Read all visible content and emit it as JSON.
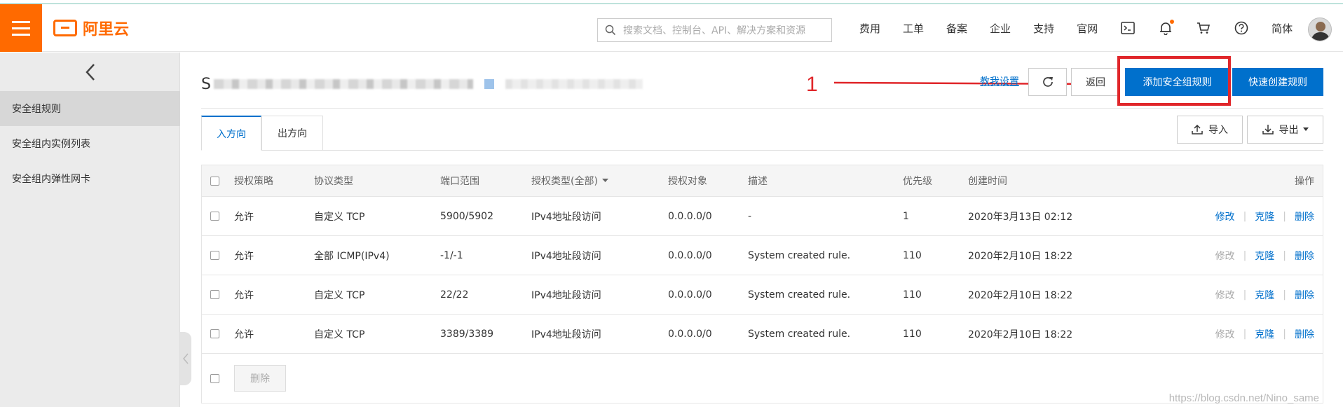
{
  "header": {
    "brand": "阿里云",
    "search_placeholder": "搜索文档、控制台、API、解决方案和资源",
    "nav": [
      "费用",
      "工单",
      "备案",
      "企业",
      "支持",
      "官网"
    ],
    "lang": "简体"
  },
  "sidebar": {
    "items": [
      {
        "label": "安全组规则",
        "active": true
      },
      {
        "label": "安全组内实例列表",
        "active": false
      },
      {
        "label": "安全组内弹性网卡",
        "active": false
      }
    ]
  },
  "page": {
    "title_prefix": "S",
    "annotation_number": "1",
    "help_link": "教我设置",
    "back_label": "返回",
    "add_rule_label": "添加安全组规则",
    "quick_rule_label": "快速创建规则",
    "import_label": "导入",
    "export_label": "导出",
    "tabs": [
      {
        "label": "入方向",
        "active": true
      },
      {
        "label": "出方向",
        "active": false
      }
    ]
  },
  "table": {
    "columns": [
      "授权策略",
      "协议类型",
      "端口范围",
      "授权类型(全部)",
      "授权对象",
      "描述",
      "优先级",
      "创建时间",
      "操作"
    ],
    "rows": [
      {
        "policy": "允许",
        "protocol": "自定义 TCP",
        "port": "5900/5902",
        "auth_type": "IPv4地址段访问",
        "target": "0.0.0.0/0",
        "desc": "-",
        "priority": "1",
        "created": "2020年3月13日 02:12",
        "edit_enabled": true
      },
      {
        "policy": "允许",
        "protocol": "全部 ICMP(IPv4)",
        "port": "-1/-1",
        "auth_type": "IPv4地址段访问",
        "target": "0.0.0.0/0",
        "desc": "System created rule.",
        "priority": "110",
        "created": "2020年2月10日 18:22",
        "edit_enabled": false
      },
      {
        "policy": "允许",
        "protocol": "自定义 TCP",
        "port": "22/22",
        "auth_type": "IPv4地址段访问",
        "target": "0.0.0.0/0",
        "desc": "System created rule.",
        "priority": "110",
        "created": "2020年2月10日 18:22",
        "edit_enabled": false
      },
      {
        "policy": "允许",
        "protocol": "自定义 TCP",
        "port": "3389/3389",
        "auth_type": "IPv4地址段访问",
        "target": "0.0.0.0/0",
        "desc": "System created rule.",
        "priority": "110",
        "created": "2020年2月10日 18:22",
        "edit_enabled": false
      }
    ],
    "actions": {
      "edit": "修改",
      "clone": "克隆",
      "delete": "删除"
    },
    "bulk_delete": "删除"
  },
  "watermark": "https://blog.csdn.net/Nino_same",
  "colors": {
    "brand": "#ff6a00",
    "primary": "#0070cc",
    "annotation": "#e0262a"
  }
}
